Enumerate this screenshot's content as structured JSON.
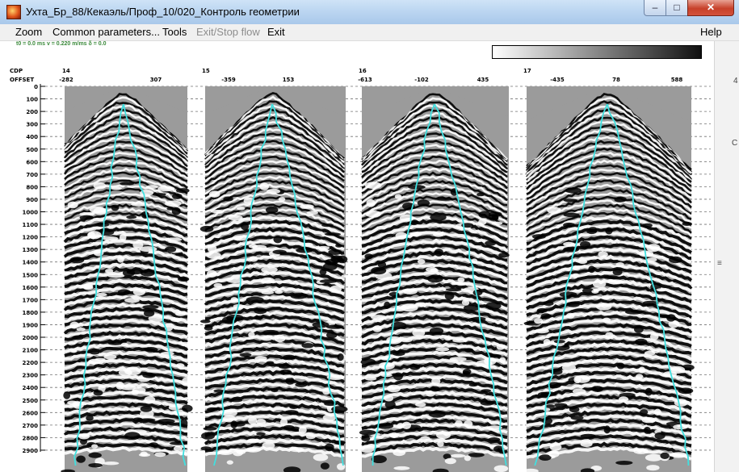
{
  "window": {
    "title": "Ухта_Бр_88/Кекаэль/Проф_10/020_Контроль геометрии",
    "minimize_glyph": "–",
    "maximize_glyph": "□",
    "close_glyph": "✕"
  },
  "menu": {
    "zoom": "Zoom",
    "common": "Common parameters...",
    "tools": "Tools",
    "exit_stop": "Exit/Stop flow",
    "exit": "Exit",
    "help": "Help"
  },
  "params_text": "t0 = 0.0 ms   v = 0.220 m/ms   δ = 0.0",
  "header_labels": {
    "cdp": "CDP",
    "offset": "OFFSET"
  },
  "time_axis": {
    "ticks": [
      "0",
      "100",
      "200",
      "300",
      "400",
      "500",
      "600",
      "700",
      "800",
      "900",
      "1000",
      "1100",
      "1200",
      "1300",
      "1400",
      "1500",
      "1600",
      "1700",
      "1800",
      "1900",
      "2000",
      "2100",
      "2200",
      "2300",
      "2400",
      "2500",
      "2600",
      "2700",
      "2800",
      "2900"
    ]
  },
  "gathers": [
    {
      "cdp": "14",
      "offsets": [
        "-282",
        "307"
      ]
    },
    {
      "cdp": "15",
      "offsets": [
        "-359",
        "153"
      ]
    },
    {
      "cdp": "16",
      "offsets": [
        "-613",
        "-102",
        "435"
      ]
    },
    {
      "cdp": "17",
      "offsets": [
        "-435",
        "78",
        "588"
      ]
    }
  ],
  "colors": {
    "overlay": "#40e0e0",
    "accent": "#3b8a3b"
  },
  "scroll_grip": "≡",
  "side_marks": [
    "4",
    "C"
  ]
}
